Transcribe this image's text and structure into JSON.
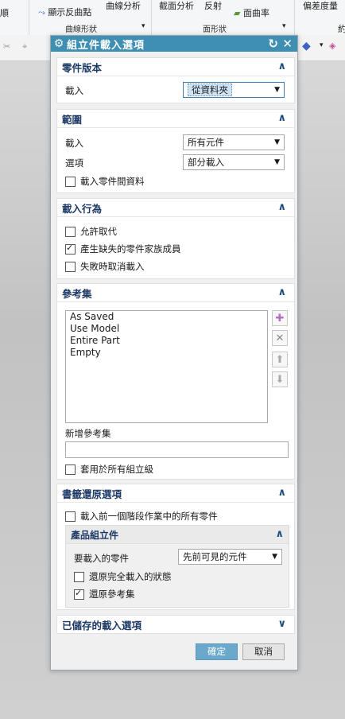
{
  "ribbon": {
    "items": [
      "顯示反曲點",
      "曲線分析",
      "截面分析",
      "反射",
      "面曲率",
      "偏差度量"
    ],
    "groups": [
      "曲線形狀",
      "面形狀"
    ],
    "left_stub": "約",
    "right_stub": "順"
  },
  "dialog": {
    "title": "組立件載入選項",
    "sections": {
      "part_versions": {
        "header": "零件版本",
        "load_label": "載入",
        "load_value": "從資料夾"
      },
      "scope": {
        "header": "範圍",
        "load_label": "載入",
        "load_value": "所有元件",
        "options_label": "選項",
        "options_value": "部分載入",
        "interpart_data": {
          "label": "載入零件間資料",
          "checked": false
        }
      },
      "load_behavior": {
        "header": "載入行為",
        "allow_substitution": {
          "label": "允許取代",
          "checked": false
        },
        "generate_missing": {
          "label": "產生缺失的零件家族成員",
          "checked": true
        },
        "cancel_on_failure": {
          "label": "失敗時取消載入",
          "checked": false
        }
      },
      "reference_sets": {
        "header": "參考集",
        "items": [
          "As Saved",
          "Use Model",
          "Entire Part",
          "Empty"
        ],
        "new_label": "新增參考集",
        "new_value": "",
        "apply_all": {
          "label": "套用於所有組立級",
          "checked": false
        }
      },
      "bookmark_restore": {
        "header": "書籤還原選項",
        "load_all_parts": {
          "label": "載入前一個階段作業中的所有零件",
          "checked": false
        },
        "product_assembly": {
          "header": "產品組立件",
          "components_label": "要載入的零件",
          "components_value": "先前可見的元件",
          "restore_full_load": {
            "label": "還原完全載入的狀態",
            "checked": false
          },
          "restore_ref_sets": {
            "label": "還原參考集",
            "checked": true
          }
        }
      },
      "saved_options": {
        "header": "已儲存的載入選項"
      }
    },
    "buttons": {
      "ok": "確定",
      "cancel": "取消"
    }
  }
}
